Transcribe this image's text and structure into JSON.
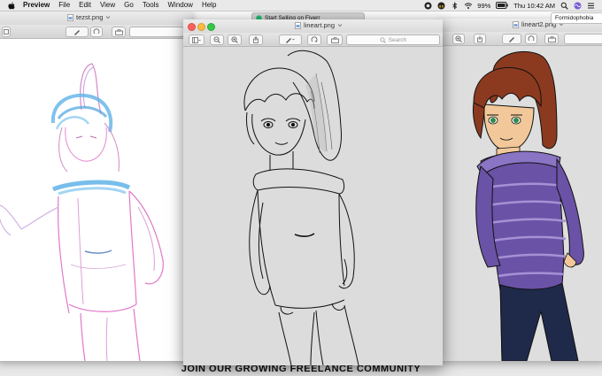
{
  "menubar": {
    "app_name": "Preview",
    "items": [
      "File",
      "Edit",
      "View",
      "Go",
      "Tools",
      "Window",
      "Help"
    ],
    "battery": "99%",
    "clock": "Thu 10:42 AM"
  },
  "background_tabs": {
    "tab1": "Start Selling on Fiverr",
    "tab2": "Formidophobia"
  },
  "windows": {
    "left": {
      "title": "tezst.png"
    },
    "center": {
      "title": "lineart.png",
      "search_placeholder": "Search"
    },
    "right": {
      "title": "lineart2.png"
    }
  },
  "banner": {
    "text": "JOIN OUR GROWING FREELANCE COMMUNITY"
  },
  "colors": {
    "hair": "#8b3a1f",
    "sweater": "#6a52a6",
    "stripe": "#a790d4",
    "jeans": "#1f2a4a",
    "skin": "#f2c89a",
    "eyes": "#2e8a4a"
  }
}
